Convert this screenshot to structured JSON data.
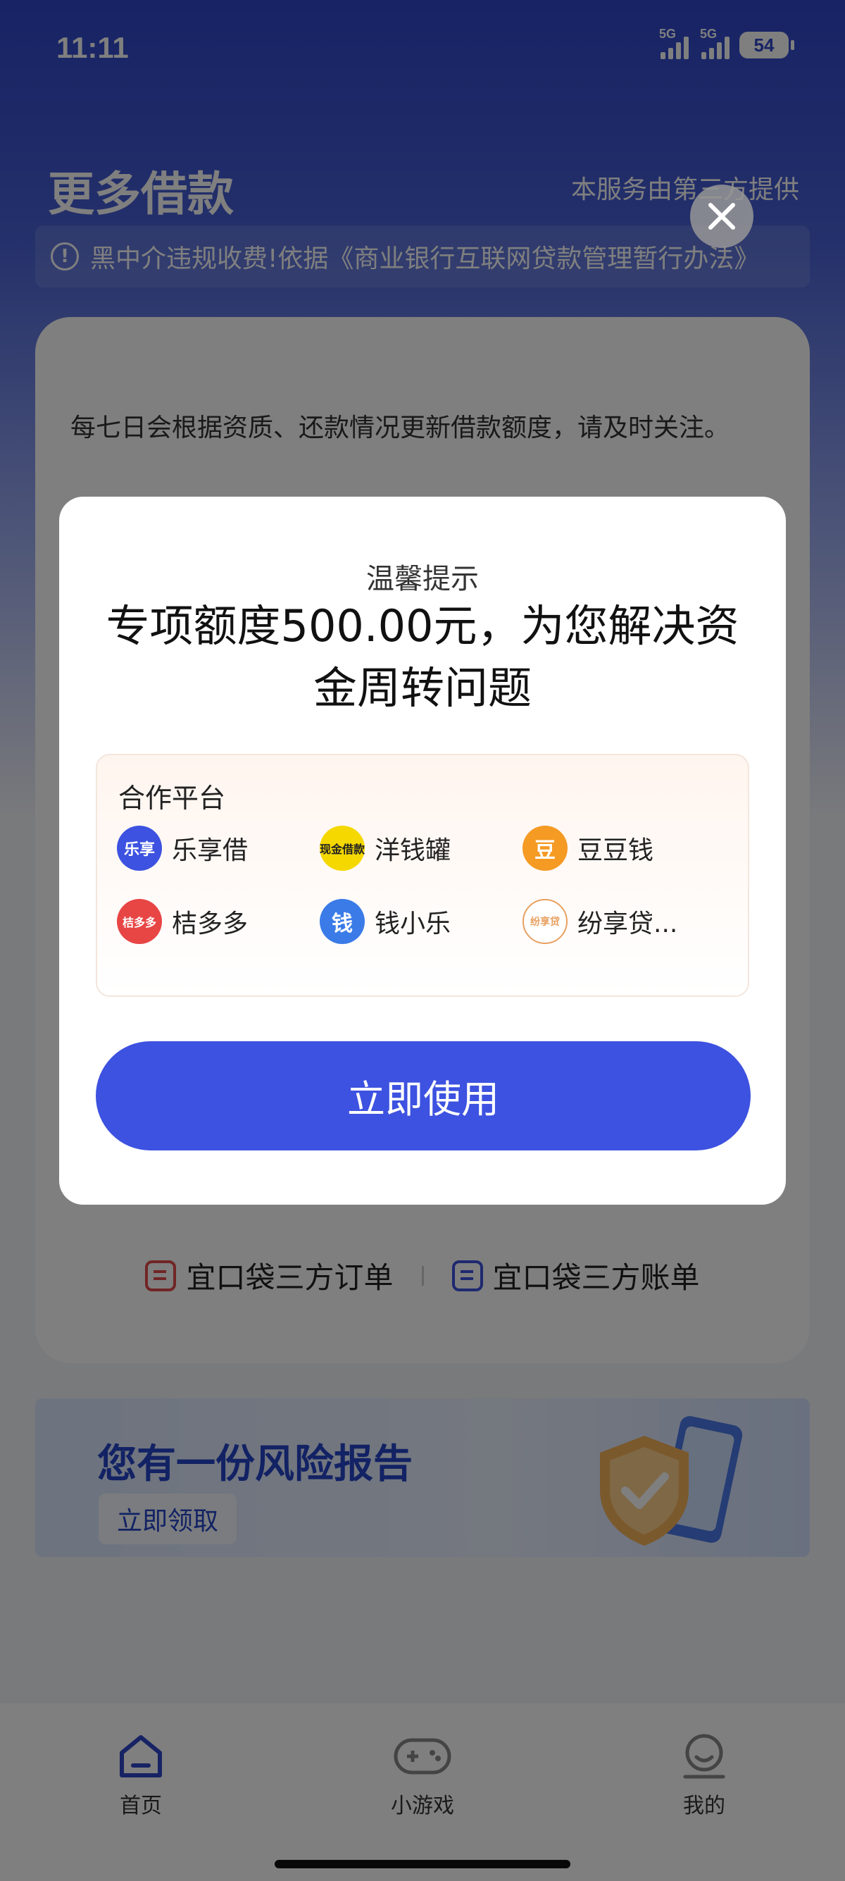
{
  "status_bar": {
    "time": "11:11",
    "signal_1_label": "5G",
    "signal_2_label": "5G",
    "battery": "54"
  },
  "header": {
    "title": "更多借款",
    "provider_note": "本服务由第三方提供"
  },
  "notice": {
    "text": "黑中介违规收费!依据《商业银行互联网贷款管理暂行办法》"
  },
  "card": {
    "description": "每七日会根据资质、还款情况更新借款额度，请及时关注。"
  },
  "footer_links": {
    "orders": "宜口袋三方订单",
    "bills": "宜口袋三方账单"
  },
  "risk_banner": {
    "title": "您有一份风险报告",
    "button": "立即领取"
  },
  "bottom_nav": {
    "home": "首页",
    "games": "小游戏",
    "mine": "我的"
  },
  "modal": {
    "subtitle": "温馨提示",
    "title": "专项额度500.00元，为您解决资金周转问题",
    "partner_heading": "合作平台",
    "partners": [
      {
        "name": "乐享借",
        "logo_text": "乐享",
        "color": "#3d52e0"
      },
      {
        "name": "洋钱罐",
        "logo_text": "现金借款",
        "color": "#f5d800"
      },
      {
        "name": "豆豆钱",
        "logo_text": "豆",
        "color": "#f59a23"
      },
      {
        "name": "桔多多",
        "logo_text": "桔多多",
        "color": "#e84545"
      },
      {
        "name": "钱小乐",
        "logo_text": "钱",
        "color": "#3a7be8"
      },
      {
        "name": "纷享贷...",
        "logo_text": "纷享贷",
        "color": "#e8a060"
      }
    ],
    "button": "立即使用"
  }
}
